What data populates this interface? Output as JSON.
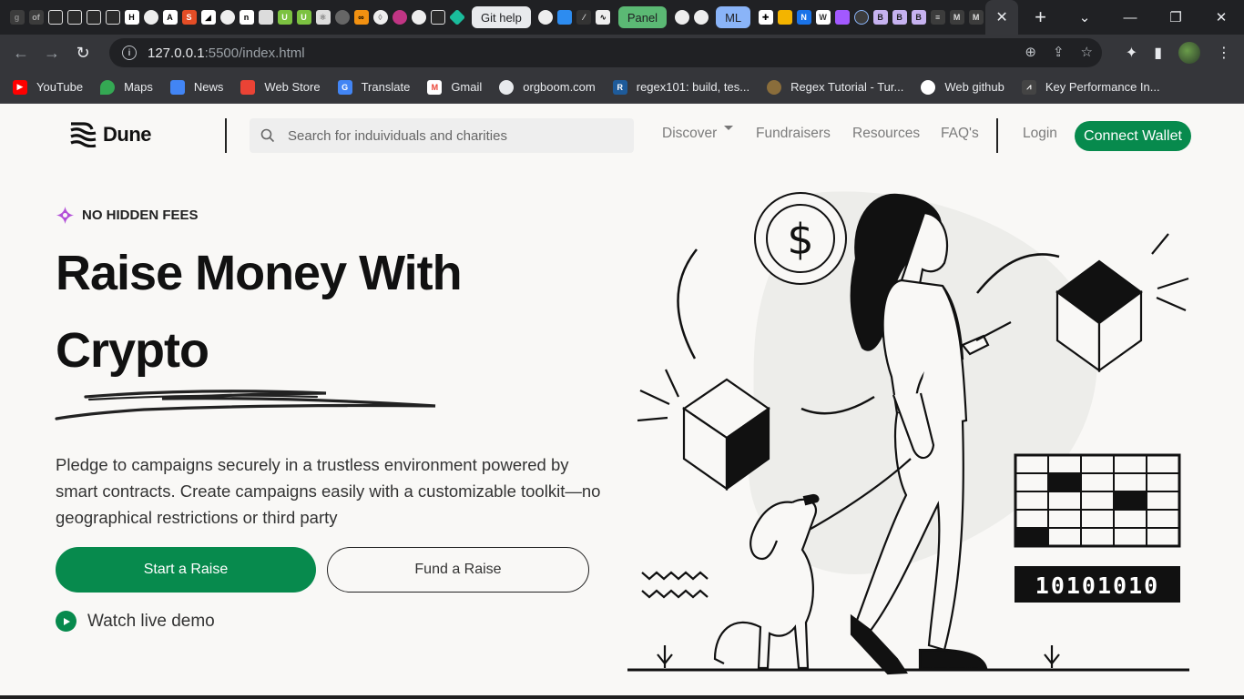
{
  "browser": {
    "tab_pills": {
      "git_help": "Git help",
      "panel": "Panel",
      "ml": "ML"
    },
    "url": {
      "host": "127.0.0.1",
      "path": ":5500/index.html"
    },
    "bookmarks": [
      "YouTube",
      "Maps",
      "News",
      "Web Store",
      "Translate",
      "Gmail",
      "orgboom.com",
      "regex101: build, tes...",
      "Regex Tutorial - Tur...",
      "Web github",
      "Key Performance In..."
    ],
    "window_controls": {
      "minimize": "—",
      "restore": "❐",
      "close": "✕"
    },
    "chevron": "⌄"
  },
  "site": {
    "logo_text": "Dune",
    "search_placeholder": "Search for induividuals and charities",
    "nav": {
      "discover": "Discover",
      "fundraisers": "Fundraisers",
      "resources": "Resources",
      "faqs": "FAQ's"
    },
    "login": "Login",
    "connect_wallet": "Connect Wallet"
  },
  "hero": {
    "badge": "NO HIDDEN FEES",
    "title_line1": "Raise Money With",
    "title_line2": "Crypto",
    "description": "Pledge to campaigns securely in a trustless environment powered by smart contracts. Create campaigns easily with a customizable toolkit—no geographical restrictions or third party",
    "start_raise": "Start a Raise",
    "fund_raise": "Fund a Raise",
    "watch_demo": "Watch live demo",
    "binary_text": "10101010",
    "dollar_symbol": "$"
  },
  "colors": {
    "brand_green": "#078a4d",
    "badge_purple": "#b24fd8",
    "text_dark": "#111111",
    "page_bg": "#f9f8f6"
  }
}
